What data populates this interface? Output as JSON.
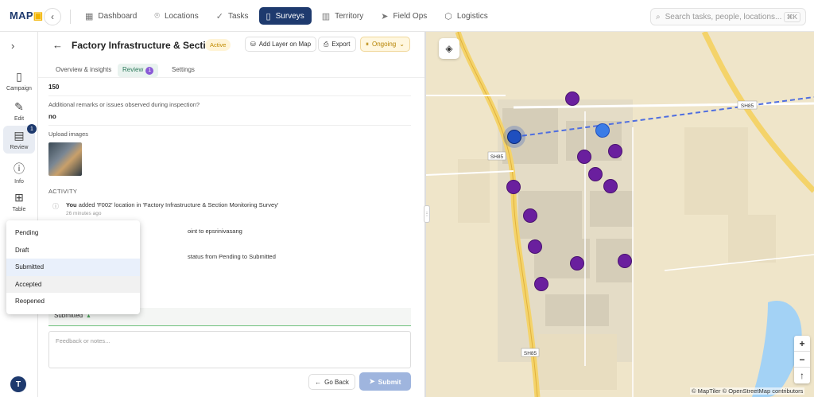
{
  "app": {
    "logo_main": "MAP",
    "logo_accent": "▣"
  },
  "nav": {
    "items": [
      {
        "label": "Dashboard",
        "icon": "dashboard-icon"
      },
      {
        "label": "Locations",
        "icon": "pin-icon"
      },
      {
        "label": "Tasks",
        "icon": "check-icon"
      },
      {
        "label": "Surveys",
        "icon": "clipboard-icon"
      },
      {
        "label": "Territory",
        "icon": "map-icon"
      },
      {
        "label": "Field Ops",
        "icon": "send-icon"
      },
      {
        "label": "Logistics",
        "icon": "box-icon"
      }
    ],
    "active": "Surveys"
  },
  "search": {
    "placeholder": "Search tasks, people, locations...",
    "shortcut": "⌘K"
  },
  "sidebar": {
    "items": [
      {
        "label": "Campaign",
        "icon": "clipboard-icon"
      },
      {
        "label": "Edit",
        "icon": "edit-icon"
      },
      {
        "label": "Review",
        "icon": "file-icon",
        "badge": "1"
      },
      {
        "label": "Info",
        "icon": "info-icon"
      },
      {
        "label": "Table",
        "icon": "grid-icon"
      }
    ],
    "avatar": "T"
  },
  "panel": {
    "title": "Factory Infrastructure & Section ...",
    "status": "Active",
    "add_layer": "Add Layer on Map",
    "export": "Export",
    "ongoing": "Ongoing",
    "tabs": [
      "Overview & insights",
      "Review",
      "Settings"
    ],
    "review_count": "1"
  },
  "fields": [
    {
      "value": "150"
    },
    {
      "label": "Additional remarks or issues observed during inspection?",
      "value": "no"
    },
    {
      "label": "Upload images"
    }
  ],
  "activity": {
    "heading": "ACTIVITY",
    "entries": [
      {
        "actor": "You",
        "text": " added 'F002' location in 'Factory Infrastructure & Section Monitoring Survey'",
        "time": "26 minutes ago"
      },
      {
        "text": "oint to epsrinivasang"
      },
      {
        "text": "status from Pending to Submitted"
      }
    ]
  },
  "status_select": {
    "value": "Submitted",
    "options": [
      "Pending",
      "Draft",
      "Submitted",
      "Accepted",
      "Reopened"
    ],
    "selected": "Submitted",
    "hovered": "Accepted"
  },
  "feedback": {
    "placeholder": "Feedback or notes..."
  },
  "actions": {
    "go_back": "Go Back",
    "submit": "Submit"
  },
  "map": {
    "road_labels": [
      "SH85",
      "SH85",
      "SH85"
    ],
    "attribution": "© MapTiler © OpenStreetMap contributors",
    "zoom_in": "+",
    "zoom_out": "−",
    "compass": "↑"
  },
  "colors": {
    "primary": "#1e3a6e",
    "point": "#6a1f9e",
    "selected_point": "#1f4fbf",
    "route": "#4f6ee0"
  }
}
